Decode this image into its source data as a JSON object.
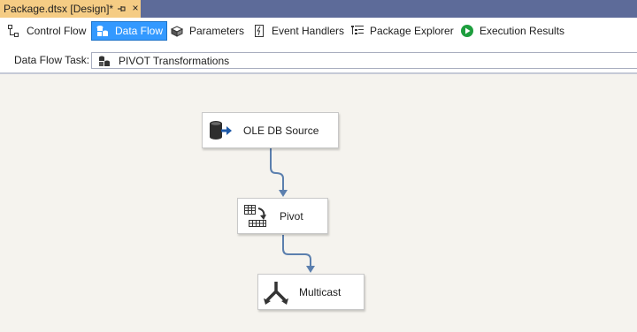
{
  "document_tab": {
    "title": "Package.dtsx [Design]*",
    "pin_icon": "pin-icon",
    "close_glyph": "×"
  },
  "designer_tabs": [
    {
      "label": "Control Flow",
      "icon": "control-flow-icon",
      "active": false
    },
    {
      "label": "Data Flow",
      "icon": "data-flow-icon",
      "active": true
    },
    {
      "label": "Parameters",
      "icon": "parameters-icon",
      "active": false
    },
    {
      "label": "Event Handlers",
      "icon": "event-handlers-icon",
      "active": false
    },
    {
      "label": "Package Explorer",
      "icon": "package-explorer-icon",
      "active": false
    },
    {
      "label": "Execution Results",
      "icon": "execution-results-icon",
      "active": false
    }
  ],
  "task_bar": {
    "label": "Data Flow Task:",
    "selected_task": "PIVOT Transformations",
    "icon": "data-flow-task-icon"
  },
  "components": [
    {
      "label": "OLE DB Source",
      "icon": "ole-db-source-icon"
    },
    {
      "label": "Pivot",
      "icon": "pivot-icon"
    },
    {
      "label": "Multicast",
      "icon": "multicast-icon"
    }
  ],
  "colors": {
    "tab_strip": "#5d6b99",
    "active_doc_tab": "#f5cc84",
    "active_designer_tab": "#3399ff",
    "canvas": "#f5f3ee",
    "connector": "#5b7fae"
  }
}
